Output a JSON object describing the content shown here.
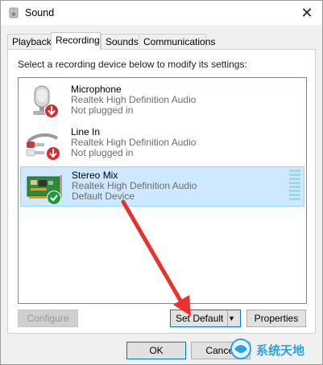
{
  "window": {
    "title": "Sound",
    "close_glyph": "✕"
  },
  "tabs": [
    {
      "label": "Playback"
    },
    {
      "label": "Recording"
    },
    {
      "label": "Sounds"
    },
    {
      "label": "Communications"
    }
  ],
  "active_tab": "Recording",
  "panel": {
    "instruction": "Select a recording device below to modify its settings:",
    "devices": [
      {
        "name": "Microphone",
        "driver": "Realtek High Definition Audio",
        "status": "Not plugged in",
        "icon": "microphone-icon",
        "badge": "down-arrow-red-badge"
      },
      {
        "name": "Line In",
        "driver": "Realtek High Definition Audio",
        "status": "Not plugged in",
        "icon": "line-in-cable-icon",
        "badge": "down-arrow-red-badge"
      },
      {
        "name": "Stereo Mix",
        "driver": "Realtek High Definition Audio",
        "status": "Default Device",
        "icon": "sound-card-icon",
        "badge": "green-check-badge"
      }
    ],
    "selected_device": "Stereo Mix"
  },
  "buttons": {
    "configure": "Configure",
    "set_default": "Set Default",
    "set_default_arrow": "▼",
    "properties": "Properties",
    "ok": "OK",
    "cancel": "Cancel"
  },
  "colors": {
    "selection_bg": "#cde8ff",
    "annotation_arrow": "#e8322b",
    "check_badge": "#1a9a3a",
    "down_badge": "#d32f2f"
  },
  "watermark": {
    "text": "系统天地"
  }
}
